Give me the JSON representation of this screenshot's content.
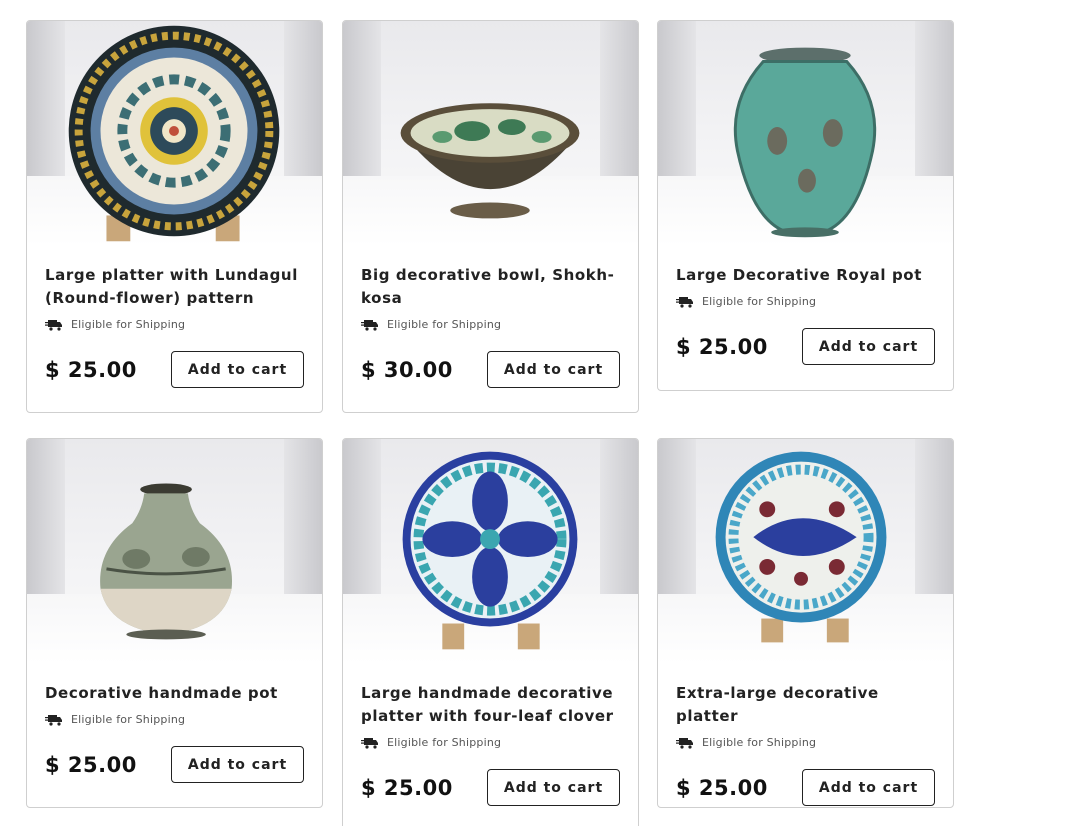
{
  "products": [
    {
      "title": "Large platter with Lundagul (Round-flower) pattern",
      "shipping": "Eligible for Shipping",
      "price": "$ 25.00",
      "button": "Add to cart",
      "image_icon": "platter-image"
    },
    {
      "title": "Big decorative bowl, Shokh-kosa",
      "shipping": "Eligible for Shipping",
      "price": "$ 30.00",
      "button": "Add to cart",
      "image_icon": "bowl-image"
    },
    {
      "title": "Large Decorative Royal pot",
      "shipping": "Eligible for Shipping",
      "price": "$ 25.00",
      "button": "Add to cart",
      "image_icon": "vase-image"
    },
    {
      "title": "Decorative handmade pot",
      "shipping": "Eligible for Shipping",
      "price": "$ 25.00",
      "button": "Add to cart",
      "image_icon": "pot-image"
    },
    {
      "title": "Large handmade decorative platter with four-leaf clover",
      "shipping": "Eligible for Shipping",
      "price": "$ 25.00",
      "button": "Add to cart",
      "image_icon": "clover-platter-image"
    },
    {
      "title": "Extra-large decorative platter",
      "shipping": "Eligible for Shipping",
      "price": "$ 25.00",
      "button": "Add to cart",
      "image_icon": "fish-platter-image"
    }
  ],
  "colors": {
    "border": "#cfcfcf",
    "text": "#222222",
    "button_border": "#222222"
  }
}
